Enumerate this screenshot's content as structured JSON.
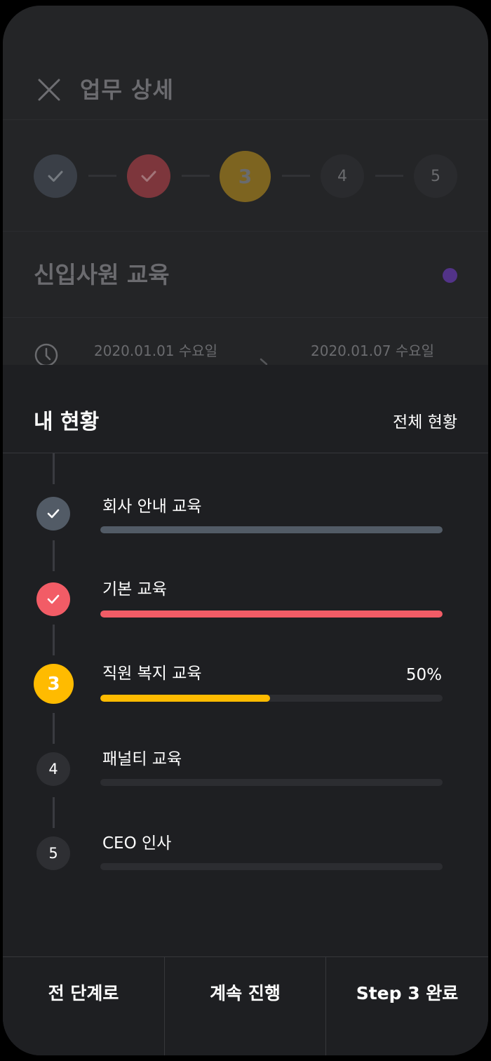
{
  "header": {
    "title": "업무 상세",
    "close_icon": "close-icon"
  },
  "stepper": {
    "steps": [
      {
        "label": "",
        "state": "done",
        "color": "#5e6670",
        "icon": "check-icon"
      },
      {
        "label": "",
        "state": "done",
        "color": "#c94950",
        "icon": "check-icon"
      },
      {
        "label": "3",
        "state": "current",
        "color": "#c79a2e"
      },
      {
        "label": "4",
        "state": "pending"
      },
      {
        "label": "5",
        "state": "pending"
      }
    ]
  },
  "task": {
    "title": "신입사원 교육",
    "status_color": "#6a3fb4",
    "start_date": "2020.01.01 수요일",
    "end_date": "2020.01.07 수요일"
  },
  "sheet": {
    "title": "내 현황",
    "all_status_label": "전체 현황",
    "items": [
      {
        "step": "",
        "label": "회사 안내 교육",
        "state": "done",
        "color": "#525b66",
        "progress": 1.0,
        "icon": "check-icon"
      },
      {
        "step": "",
        "label": "기본 교육",
        "state": "done",
        "color": "#f25c66",
        "progress": 1.0,
        "icon": "check-icon"
      },
      {
        "step": "3",
        "label": "직원 복지 교육",
        "state": "current",
        "color": "#ffbb00",
        "progress": 0.5,
        "percent": "50%"
      },
      {
        "step": "4",
        "label": "패널티 교육",
        "state": "pending",
        "progress": 0
      },
      {
        "step": "5",
        "label": "CEO 인사",
        "state": "pending",
        "progress": 0
      }
    ]
  },
  "footer": {
    "prev_label": "전 단계로",
    "continue_label": "계속 진행",
    "complete_label": "Step 3 완료"
  },
  "colors": {
    "background": "#1e1f22",
    "pending_dot": "#2e2f33",
    "divider": "#36373b"
  }
}
